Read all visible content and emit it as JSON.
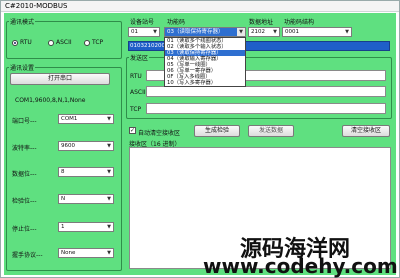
{
  "window": {
    "title": "C#2010-MODBUS"
  },
  "comm_mode": {
    "legend": "通讯模式",
    "options": [
      {
        "label": "RTU",
        "selected": true
      },
      {
        "label": "ASCII",
        "selected": false
      },
      {
        "label": "TCP",
        "selected": false
      }
    ]
  },
  "comm_settings": {
    "legend": "通讯设置",
    "open_port_button": "打开串口",
    "status": "COM1,9600,8,N,1,None",
    "fields": [
      {
        "label": "端口号---",
        "value": "COM1"
      },
      {
        "label": "波特率---",
        "value": "9600"
      },
      {
        "label": "数据位---",
        "value": "8"
      },
      {
        "label": "检验位---",
        "value": "N"
      },
      {
        "label": "停止位---",
        "value": "1"
      },
      {
        "label": "握手协议---",
        "value": "None"
      }
    ]
  },
  "top_bar": {
    "station_label": "设备站号",
    "station_value": "01",
    "func_label": "功能码",
    "func_value": "03（读取保持寄存器）",
    "addr_label": "数据地址",
    "addr_value": "2102",
    "struct_label": "功能码结构",
    "struct_value": "0001",
    "hex_frame": "0103210200"
  },
  "func_dropdown": [
    {
      "label": "01（读取多个线圈状态）",
      "selected": false
    },
    {
      "label": "02（读取多个输入状态）",
      "selected": false
    },
    {
      "label": "03（读取保持寄存器）",
      "selected": true
    },
    {
      "label": "04（读取输入寄存器）",
      "selected": false
    },
    {
      "label": "05（写单一线圈）",
      "selected": false
    },
    {
      "label": "06（写单一寄存器）",
      "selected": false
    },
    {
      "label": "0F（写入多线圈）",
      "selected": false
    },
    {
      "label": "10（写入多寄存器）",
      "selected": false
    }
  ],
  "send_area": {
    "legend": "发送区",
    "rows": [
      "RTU",
      "ASCII",
      "TCP"
    ]
  },
  "controls": {
    "auto_clear_label": "自动清空接收区",
    "auto_clear_checked": true,
    "generate_button": "生成检验",
    "send_button": "发送数据",
    "clear_button": "清空接收区"
  },
  "receive_area": {
    "label": "接收区（16 进制）"
  },
  "watermark": {
    "line1": "源码海洋网",
    "line2": "www.codehy.com"
  }
}
